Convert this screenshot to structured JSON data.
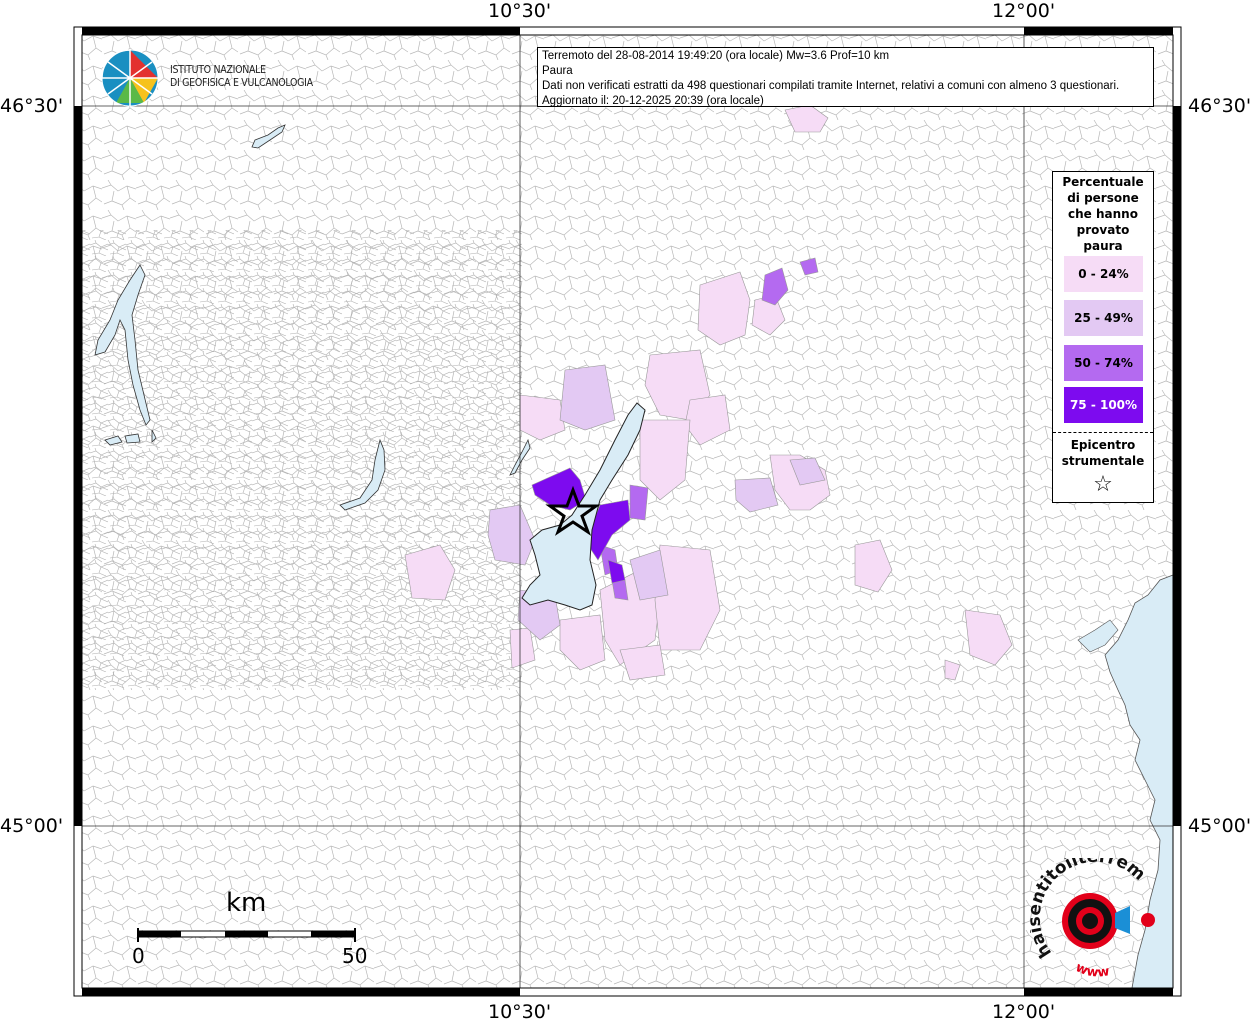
{
  "coords": {
    "top_left_lon": "10°30'",
    "top_right_lon": "12°00'",
    "bottom_left_lon": "10°30'",
    "bottom_right_lon": "12°00'",
    "left_upper_lat": "46°30'",
    "left_lower_lat": "45°00'",
    "right_upper_lat": "46°30'",
    "right_lower_lat": "45°00'"
  },
  "header": {
    "line1": "Terremoto del 28-08-2014 19:49:20 (ora locale) Mw=3.6 Prof=10 km",
    "line2": "Paura",
    "line3": "Dati non verificati estratti da 498 questionari compilati tramite Internet, relativi a comuni con almeno 3 questionari.",
    "line4": "Aggiornato il: 20-12-2025 20:39 (ora locale)"
  },
  "logo": {
    "line1": "ISTITUTO NAZIONALE",
    "line2": "DI GEOFISICA E VULCANOLOGIA"
  },
  "legend": {
    "title_lines": [
      "Percentuale",
      "di persone",
      "che hanno",
      "provato",
      "paura"
    ],
    "classes": [
      {
        "label": "0 - 24%",
        "color": "#f6dcf6",
        "text_color": "#000000"
      },
      {
        "label": "25 - 49%",
        "color": "#e3c9f3",
        "text_color": "#000000"
      },
      {
        "label": "50 - 74%",
        "color": "#b46af0",
        "text_color": "#000000"
      },
      {
        "label": "75 - 100%",
        "color": "#7d0bef",
        "text_color": "#ffffff"
      }
    ],
    "epicenter_line1": "Epicentro",
    "epicenter_line2": "strumentale",
    "epicenter_symbol": "☆"
  },
  "scale": {
    "unit": "km",
    "min": "0",
    "max": "50"
  },
  "watermark": {
    "text_main": "haisentitoilterremoto.it",
    "text_www": "www",
    "brand_color": "#e2001a"
  },
  "colors": {
    "water": "#d9ecf6",
    "border": "#888888",
    "frame": "#000000"
  }
}
